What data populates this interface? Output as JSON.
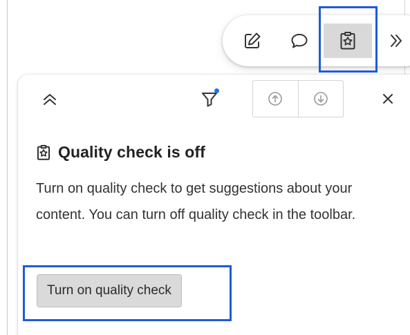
{
  "toolbar": {
    "buttons": [
      {
        "id": "edit",
        "icon": "pencil-icon"
      },
      {
        "id": "comment",
        "icon": "comment-bubble-icon"
      },
      {
        "id": "quality",
        "icon": "quality-check-icon",
        "selected": true
      },
      {
        "id": "more",
        "icon": "double-chevron-right-icon"
      }
    ]
  },
  "panel": {
    "header": {
      "collapse_icon": "double-chevron-up-icon",
      "filter_icon": "filter-icon",
      "prev_icon": "arrow-up-circle-icon",
      "next_icon": "arrow-down-circle-icon",
      "close_icon": "close-icon"
    },
    "title": "Quality check is off",
    "description": "Turn on quality check to get suggestions about your content. You can turn off quality check in the toolbar.",
    "turn_on_label": "Turn on quality check"
  },
  "colors": {
    "highlight": "#1f5ad9",
    "selected_bg": "#d9d9d9",
    "filter_dot": "#1a73e8",
    "button_bg": "#dadada"
  }
}
